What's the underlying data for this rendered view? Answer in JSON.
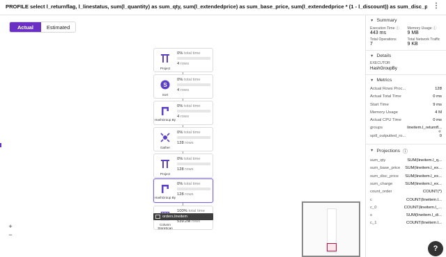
{
  "query": "PROFILE select l_returnflag, l_linestatus, sum(l_quantity) as sum_qty, sum(l_extendedprice) as sum_base_price, sum(l_extendedprice * (1 - l_discount)) as sum_disc_price, sum(l_extendedprice * (1 - l_d...",
  "toggle": {
    "actual": "Actual",
    "estimated": "Estimated"
  },
  "pct_unit": "total time",
  "rows_unit": "rows",
  "nodes": [
    {
      "label": "Project",
      "pct": "0%",
      "rows": "4",
      "icon": "project-icon"
    },
    {
      "label": "Sort",
      "pct": "0%",
      "rows": "4",
      "icon": "sort-icon"
    },
    {
      "label": "HashGroup By",
      "pct": "0%",
      "rows": "4",
      "icon": "hashgroupby-icon"
    },
    {
      "label": "Gather",
      "pct": "0%",
      "rows": "128",
      "icon": "gather-icon"
    },
    {
      "label": "Project",
      "pct": "0%",
      "rows": "128",
      "icon": "project-icon"
    },
    {
      "label": "HashGroup By",
      "pct": "0%",
      "rows": "128",
      "icon": "hashgroupby-icon"
    },
    {
      "label": "Column StoreScan",
      "pct": "100%",
      "rows": "539.2M",
      "icon": "columnstore-scan-icon",
      "fill": 1.0
    }
  ],
  "table_label": "orders.lineitem",
  "zoom": {
    "in": "+",
    "out": "−"
  },
  "summary": {
    "title": "Summary",
    "exec_time_label": "Execution Time",
    "exec_time": "443 ms",
    "memory_label": "Memory Usage",
    "memory": "9 MB",
    "ops_label": "Total Operations",
    "ops": "7",
    "network_label": "Total Network Traffic",
    "network": "9 KB"
  },
  "details": {
    "title": "Details",
    "executor_label": "EXECUTOR",
    "executor": "HashGroupBy"
  },
  "metrics": {
    "title": "Metrics",
    "items": [
      {
        "k": "Actual Rows Proc...",
        "v": "128"
      },
      {
        "k": "Actual Total Time",
        "v": "0 ms"
      },
      {
        "k": "Start Time",
        "v": "9 ms"
      },
      {
        "k": "Memory Usage",
        "v": "4 M"
      },
      {
        "k": "Actual CPU Time",
        "v": "0 ms"
      },
      {
        "k": "groups",
        "v": "lineitem.l_returnfl..."
      },
      {
        "k": "spill_outputted_ro...",
        "v": "0"
      }
    ]
  },
  "projections": {
    "title": "Projections",
    "items": [
      {
        "k": "sum_qty",
        "v": "SUM(lineitem.l_q..."
      },
      {
        "k": "sum_base_price",
        "v": "SUM(lineitem.l_ex..."
      },
      {
        "k": "sum_disc_price",
        "v": "SUM(lineitem.l_ex..."
      },
      {
        "k": "sum_charge",
        "v": "SUM(lineitem.l_ex..."
      },
      {
        "k": "count_order",
        "v": "COUNT(*)"
      },
      {
        "k": "c",
        "v": "COUNT(lineitem.l..."
      },
      {
        "k": "c_0",
        "v": "COUNT(lineitem.l_..."
      },
      {
        "k": "s",
        "v": "SUM(lineitem.l_di..."
      },
      {
        "k": "c_1",
        "v": "COUNT(lineitem.l..."
      }
    ]
  },
  "help": "?",
  "kebab": "⋮",
  "collapse": "«"
}
